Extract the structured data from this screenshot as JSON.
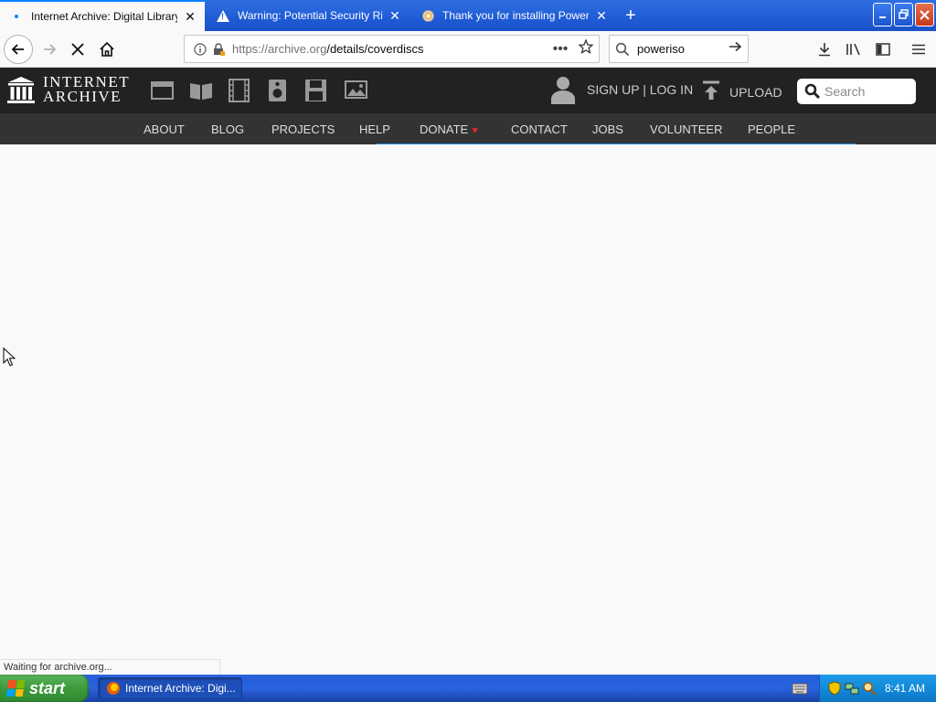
{
  "browser": {
    "tabs": [
      {
        "title": "Internet Archive: Digital Library of",
        "favicon": "loading-dot-icon",
        "active": true
      },
      {
        "title": "Warning: Potential Security Risk A",
        "favicon": "warning-icon",
        "active": false
      },
      {
        "title": "Thank you for installing PowerISO!",
        "favicon": "disc-icon",
        "active": false
      }
    ],
    "new_tab": "+",
    "url_host": "https://archive.org",
    "url_path": "/details/coverdiscs",
    "search_value": "poweriso",
    "status_text": "Waiting for archive.org..."
  },
  "ia": {
    "logo_line1": "INTERNET",
    "logo_line2": "ARCHIVE",
    "signup_login": "SIGN UP | LOG IN",
    "upload": "UPLOAD",
    "search_placeholder": "Search",
    "nav": [
      "ABOUT",
      "BLOG",
      "PROJECTS",
      "HELP",
      "DONATE",
      "CONTACT",
      "JOBS",
      "VOLUNTEER",
      "PEOPLE"
    ],
    "media_icons": [
      "web-icon",
      "texts-icon",
      "video-icon",
      "audio-icon",
      "software-icon",
      "images-icon"
    ]
  },
  "taskbar": {
    "start": "start",
    "window_item": "Internet Archive: Digi...",
    "clock": "8:41 AM"
  },
  "colors": {
    "xp_blue": "#245edb",
    "ia_dark": "#222222",
    "ia_nav": "#333333",
    "progress_blue": "#2196f3",
    "donate_heart": "#e0262d"
  }
}
